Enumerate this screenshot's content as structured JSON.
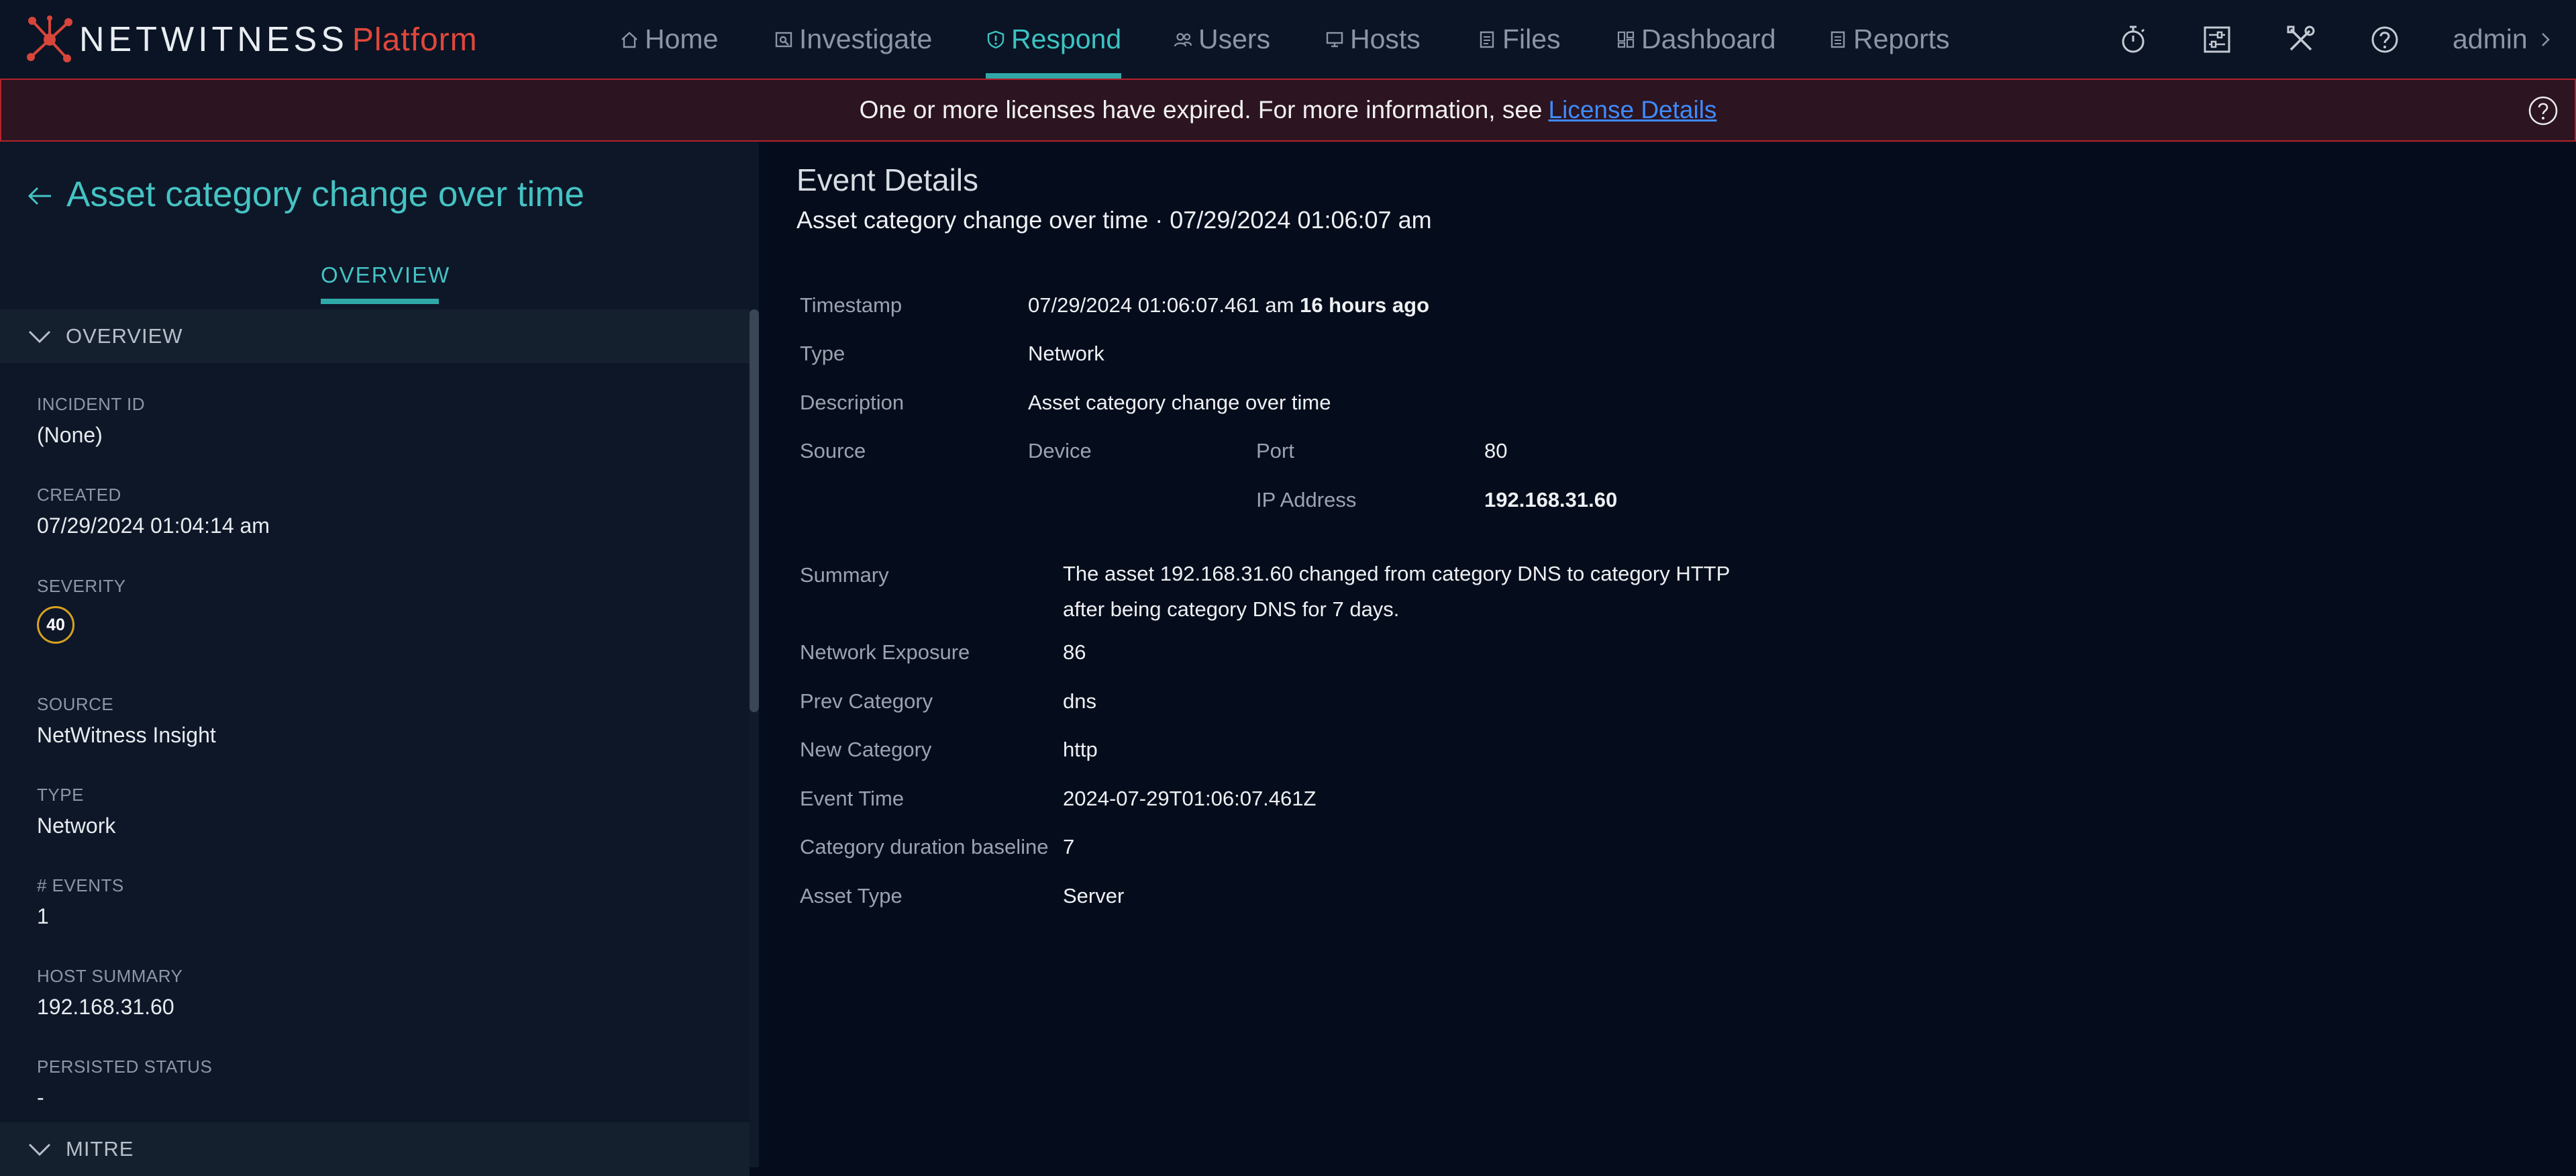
{
  "brand": {
    "name": "NETWITNESS",
    "product": "Platform"
  },
  "nav": {
    "items": [
      {
        "key": "home",
        "label": "Home"
      },
      {
        "key": "investigate",
        "label": "Investigate"
      },
      {
        "key": "respond",
        "label": "Respond",
        "active": true
      },
      {
        "key": "users",
        "label": "Users"
      },
      {
        "key": "hosts",
        "label": "Hosts"
      },
      {
        "key": "files",
        "label": "Files"
      },
      {
        "key": "dashboard",
        "label": "Dashboard"
      },
      {
        "key": "reports",
        "label": "Reports"
      }
    ],
    "user": "admin"
  },
  "banner": {
    "text": "One or more licenses have expired. For more information, see",
    "link": "License Details"
  },
  "left_panel": {
    "title": "Asset category change over time",
    "tab": "OVERVIEW",
    "overview_section": "OVERVIEW",
    "fields": [
      {
        "label": "INCIDENT ID",
        "value": "(None)"
      },
      {
        "label": "CREATED",
        "value": "07/29/2024 01:04:14 am"
      },
      {
        "label": "SEVERITY",
        "value": "40"
      },
      {
        "label": "SOURCE",
        "value": "NetWitness Insight"
      },
      {
        "label": "TYPE",
        "value": "Network"
      },
      {
        "label": "# EVENTS",
        "value": "1"
      },
      {
        "label": "HOST SUMMARY",
        "value": "192.168.31.60"
      },
      {
        "label": "PERSISTED STATUS",
        "value": "-"
      }
    ],
    "mitre_section": "MITRE"
  },
  "event": {
    "heading": "Event Details",
    "subtitle": "Asset category change over time · 07/29/2024 01:06:07 am",
    "timestamp_label": "Timestamp",
    "timestamp_value": "07/29/2024 01:06:07.461 am",
    "timestamp_relative": "16 hours ago",
    "type_label": "Type",
    "type_value": "Network",
    "description_label": "Description",
    "description_value": "Asset category change over time",
    "source_label": "Source",
    "device_label": "Device",
    "port_label": "Port",
    "port_value": "80",
    "ip_label": "IP Address",
    "ip_value": "192.168.31.60",
    "summary_label": "Summary",
    "summary_value": "The asset 192.168.31.60 changed from category DNS to category HTTP after being category DNS for 7 days.",
    "details": [
      {
        "label": "Network Exposure",
        "value": "86"
      },
      {
        "label": "Prev Category",
        "value": "dns"
      },
      {
        "label": "New Category",
        "value": "http"
      },
      {
        "label": "Event Time",
        "value": "2024-07-29T01:06:07.461Z"
      },
      {
        "label": "Category duration baseline",
        "value": "7"
      },
      {
        "label": "Asset Type",
        "value": "Server"
      }
    ]
  },
  "colors": {
    "accent": "#3cc3c3",
    "brand_red": "#e0473b",
    "banner_bg": "#2c1420",
    "banner_border": "#b3232c",
    "link": "#3f8bff",
    "severity_ring": "#d7a11f",
    "background": "#050d1c"
  },
  "icons": {
    "home": "home-icon",
    "investigate": "investigate-icon",
    "respond": "shield-icon",
    "users": "users-icon",
    "hosts": "hosts-icon",
    "files": "files-icon",
    "dashboard": "dashboard-icon",
    "reports": "reports-icon",
    "tools": [
      "stopwatch-icon",
      "sliders-icon",
      "tools-icon",
      "help-icon"
    ]
  }
}
